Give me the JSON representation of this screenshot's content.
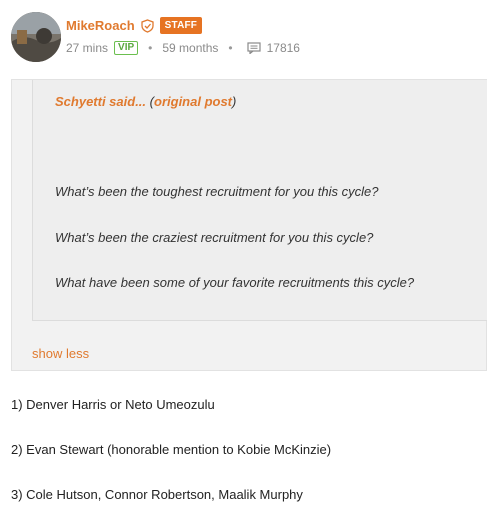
{
  "user": {
    "name": "MikeRoach",
    "badge": "STAFF",
    "time_ago": "27 mins",
    "vip": "VIP",
    "member_age": "59 months",
    "post_count": "17816"
  },
  "quote": {
    "author": "Schyetti said...",
    "link_text": "original post",
    "lines": [
      "What’s been the toughest recruitment for you this cycle?",
      "What’s been the craziest recruitment for you this cycle?",
      "What have been some of your favorite recruitments this cycle?"
    ],
    "show_less": "show less"
  },
  "answers": [
    "1) Denver Harris or Neto Umeozulu",
    "2) Evan Stewart (honorable mention to Kobie McKinzie)",
    "3) Cole Hutson, Connor Robertson, Maalik Murphy"
  ],
  "colors": {
    "accent": "#e07a2f",
    "staff_badge": "#e67322",
    "vip": "#5aa83f"
  }
}
